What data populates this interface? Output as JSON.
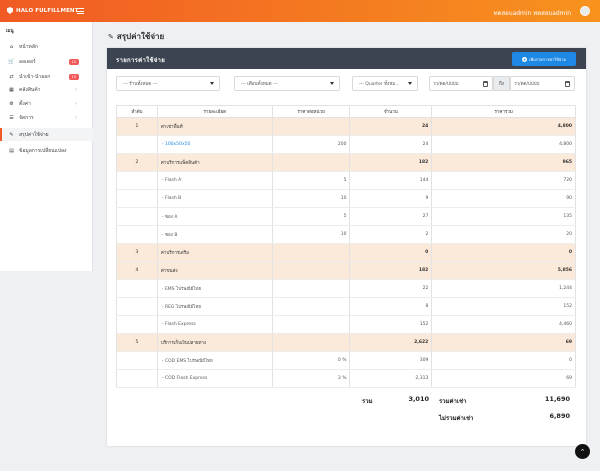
{
  "topbar": {
    "brand": "HALO FULFILLMENT",
    "user": "ทดสอบadmin ทดสอบadmin"
  },
  "sidebar": {
    "header": "เมนู",
    "items": [
      {
        "label": "หน้าหลัก",
        "icon": "home-icon",
        "glyph": "⌂"
      },
      {
        "label": "ออเดอร์",
        "icon": "cart-icon",
        "glyph": "🛒",
        "badge": "15"
      },
      {
        "label": "นำเข้า-นำออก",
        "icon": "exchange-icon",
        "glyph": "⇄",
        "badge": "15"
      },
      {
        "label": "คลังสินค้า",
        "icon": "warehouse-icon",
        "glyph": "▦",
        "chevron": "‹"
      },
      {
        "label": "ตั้งค่า",
        "icon": "gear-icon",
        "glyph": "⚙",
        "chevron": "‹"
      },
      {
        "label": "จัดการ",
        "icon": "users-icon",
        "glyph": "☰",
        "chevron": "‹"
      },
      {
        "label": "สรุปค่าใช้จ่าย",
        "icon": "pencil-icon",
        "glyph": "✎",
        "active": true
      },
      {
        "label": "ข้อมูลการเปลี่ยนแปลง",
        "icon": "book-icon",
        "glyph": "▤"
      }
    ]
  },
  "page": {
    "title": "สรุปค่าใช้จ่าย"
  },
  "card": {
    "title": "รายการค่าใช้จ่าย",
    "add_button": "เพิ่มรายการค่าใช้จ่าย"
  },
  "filters": {
    "warehouse": "--- ร้านทั้งหมด ---",
    "month": "--- เดือนทั้งหมด ---",
    "quarter": "--- Quarter ทั้งหม...",
    "date_from": "วว/ดด/ปปปป",
    "date_sep": "ถึง",
    "date_to": "วว/ดด/ปปปป"
  },
  "table": {
    "headers": [
      "ลำดับ",
      "รายละเอียด",
      "ราคาต่อหน่วย",
      "จำนวน",
      "ราคารวม"
    ],
    "rows": [
      {
        "type": "group",
        "no": "1",
        "detail": "ค่าเช่าพื้นที่",
        "unit": "",
        "qty": "24",
        "total": "4,800"
      },
      {
        "type": "item",
        "detail": "- 100x50x50",
        "unit": "200",
        "qty": "24",
        "total": "4,800",
        "link": true
      },
      {
        "type": "group",
        "no": "2",
        "detail": "ค่าบริการแพ็คสินค้า",
        "unit": "",
        "qty": "182",
        "total": "965"
      },
      {
        "type": "item",
        "detail": "- Flash A",
        "unit": "5",
        "qty": "144",
        "total": "720"
      },
      {
        "type": "item",
        "detail": "- Flash B",
        "unit": "10",
        "qty": "9",
        "total": "90"
      },
      {
        "type": "item",
        "detail": "- ซอง A",
        "unit": "5",
        "qty": "27",
        "total": "135"
      },
      {
        "type": "item",
        "detail": "- ซอง B",
        "unit": "10",
        "qty": "2",
        "total": "20"
      },
      {
        "type": "group",
        "no": "3",
        "detail": "ค่าบริการเสริม",
        "unit": "",
        "qty": "0",
        "total": "0"
      },
      {
        "type": "group",
        "no": "4",
        "detail": "ค่าขนส่ง",
        "unit": "",
        "qty": "182",
        "total": "5,856"
      },
      {
        "type": "item",
        "detail": "- EMS ไปรษณีย์ไทย",
        "unit": "",
        "qty": "22",
        "total": "1,244"
      },
      {
        "type": "item",
        "detail": "- REG ไปรษณีย์ไทย",
        "unit": "",
        "qty": "8",
        "total": "152"
      },
      {
        "type": "item",
        "detail": "- Flash Express",
        "unit": "",
        "qty": "152",
        "total": "4,460"
      },
      {
        "type": "group",
        "no": "5",
        "detail": "บริการเก็บเงินปลายทาง",
        "unit": "",
        "qty": "2,622",
        "total": "69"
      },
      {
        "type": "item",
        "detail": "- COD EMS ไปรษณีย์ไทย",
        "unit": "0 %",
        "qty": "309",
        "total": "0"
      },
      {
        "type": "item",
        "detail": "- COD Flash Express",
        "unit": "3 %",
        "qty": "2,313",
        "total": "69"
      }
    ]
  },
  "totals": {
    "sum_label": "รวม",
    "sum_qty": "3,010",
    "rent_label": "รวมค่าเช่า",
    "rent_value": "11,690",
    "no_rent_label": "ไม่รวมค่าเช่า",
    "no_rent_value": "6,890"
  },
  "colors": {
    "topbar_start": "#f15a24",
    "topbar_end": "#f7931e",
    "group_row": "#fbe9d9",
    "header_dark": "#3d4451",
    "button_blue": "#1e88e5"
  }
}
